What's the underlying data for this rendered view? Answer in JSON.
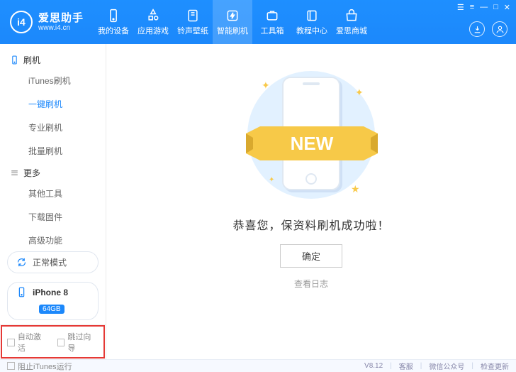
{
  "brand": {
    "logo_text": "i4",
    "name": "爱思助手",
    "domain": "www.i4.cn"
  },
  "nav": [
    {
      "label": "我的设备",
      "icon": "device"
    },
    {
      "label": "应用游戏",
      "icon": "apps"
    },
    {
      "label": "铃声壁纸",
      "icon": "ring"
    },
    {
      "label": "智能刷机",
      "icon": "flash",
      "active": true
    },
    {
      "label": "工具箱",
      "icon": "tool"
    },
    {
      "label": "教程中心",
      "icon": "book"
    },
    {
      "label": "爱思商城",
      "icon": "shop"
    }
  ],
  "win_ctrl": [
    "☰",
    "≡",
    "—",
    "□",
    "✕"
  ],
  "sidebar": {
    "groups": [
      {
        "title": "刷机",
        "icon": "phone",
        "items": [
          {
            "label": "iTunes刷机"
          },
          {
            "label": "一键刷机",
            "active": true
          },
          {
            "label": "专业刷机"
          },
          {
            "label": "批量刷机"
          }
        ]
      },
      {
        "title": "更多",
        "icon": "more",
        "items": [
          {
            "label": "其他工具"
          },
          {
            "label": "下载固件"
          },
          {
            "label": "高级功能"
          }
        ]
      }
    ],
    "mode": {
      "label": "正常模式",
      "color": "#1c88fb"
    },
    "device": {
      "name": "iPhone 8",
      "storage": "64GB"
    },
    "bottom_opts": [
      {
        "label": "自动激活"
      },
      {
        "label": "跳过向导"
      }
    ]
  },
  "content": {
    "banner_text": "NEW",
    "message": "恭喜您，保资料刷机成功啦！",
    "ok": "确定",
    "log": "查看日志"
  },
  "footer": {
    "block_itunes": "阻止iTunes运行",
    "version": "V8.12",
    "links": [
      "客服",
      "微信公众号",
      "检查更新"
    ]
  }
}
